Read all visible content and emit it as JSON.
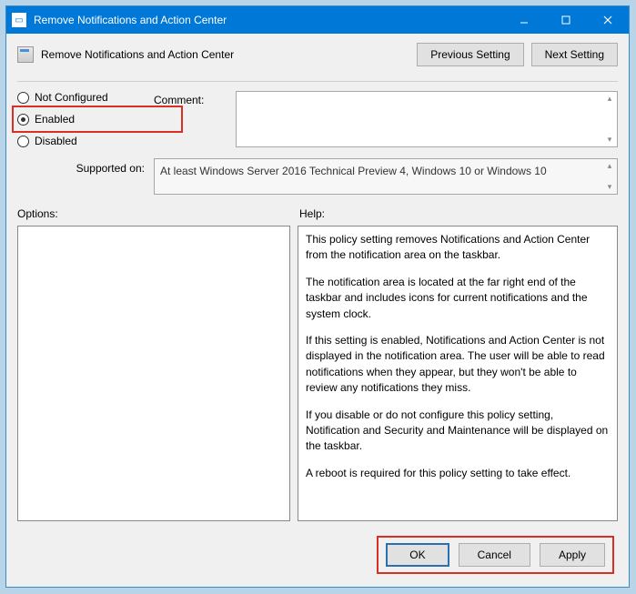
{
  "titlebar": {
    "title": "Remove Notifications and Action Center"
  },
  "header": {
    "policy_title": "Remove Notifications and Action Center",
    "prev": "Previous Setting",
    "next": "Next Setting"
  },
  "state": {
    "not_configured": "Not Configured",
    "enabled": "Enabled",
    "disabled": "Disabled",
    "selected": "enabled"
  },
  "comment": {
    "label": "Comment:",
    "value": ""
  },
  "supported": {
    "label": "Supported on:",
    "value": "At least Windows Server 2016 Technical Preview 4, Windows 10 or Windows 10"
  },
  "sections": {
    "options": "Options:",
    "help": "Help:"
  },
  "help": {
    "p1": "This policy setting removes Notifications and Action Center from the notification area on the taskbar.",
    "p2": "The notification area is located at the far right end of the taskbar and includes icons for current notifications and the system clock.",
    "p3": "If this setting is enabled, Notifications and Action Center is not displayed in the notification area. The user will be able to read notifications when they appear, but they won't be able to review any notifications they miss.",
    "p4": "If you disable or do not configure this policy setting, Notification and Security and Maintenance will be displayed on the taskbar.",
    "p5": "A reboot is required for this policy setting to take effect."
  },
  "footer": {
    "ok": "OK",
    "cancel": "Cancel",
    "apply": "Apply"
  }
}
